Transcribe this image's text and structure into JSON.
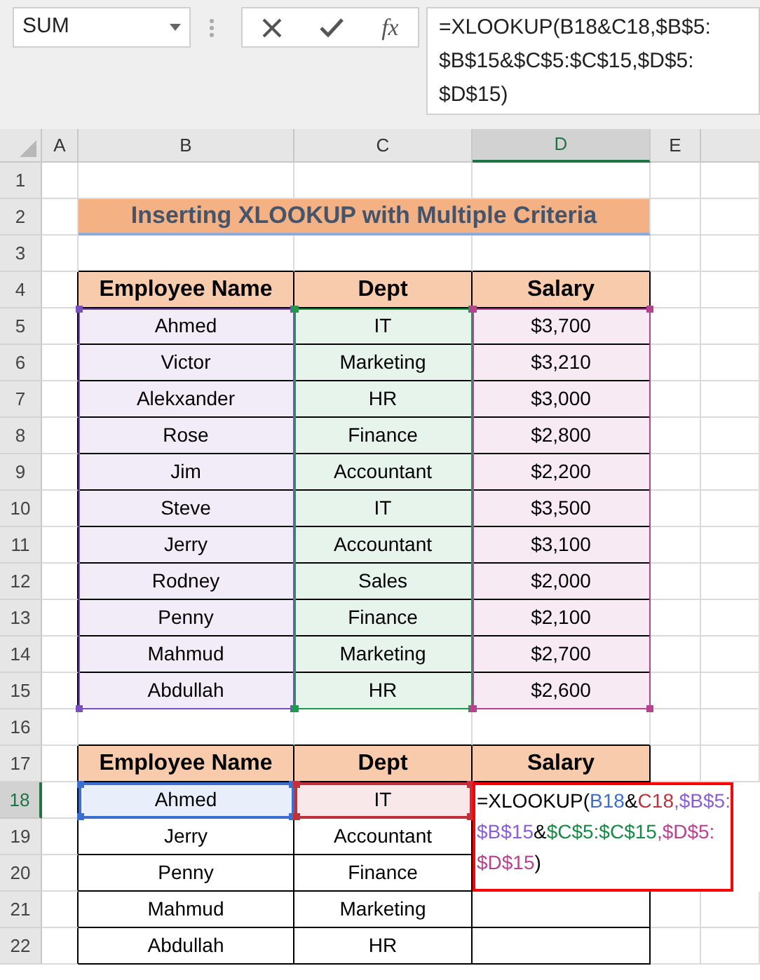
{
  "name_box": {
    "value": "SUM"
  },
  "function_button": {
    "label": "fx"
  },
  "formula_bar": {
    "lines": [
      "=XLOOKUP(B18&C18,$B$5:",
      "$B$15&$C$5:$C$15,$D$5:",
      "$D$15)"
    ]
  },
  "column_headers": [
    {
      "label": "A",
      "selected": false
    },
    {
      "label": "B",
      "selected": false
    },
    {
      "label": "C",
      "selected": false
    },
    {
      "label": "D",
      "selected": true
    },
    {
      "label": "E",
      "selected": false
    }
  ],
  "row_headers": [
    {
      "label": "1",
      "selected": false
    },
    {
      "label": "2",
      "selected": false
    },
    {
      "label": "3",
      "selected": false
    },
    {
      "label": "4",
      "selected": false
    },
    {
      "label": "5",
      "selected": false
    },
    {
      "label": "6",
      "selected": false
    },
    {
      "label": "7",
      "selected": false
    },
    {
      "label": "8",
      "selected": false
    },
    {
      "label": "9",
      "selected": false
    },
    {
      "label": "10",
      "selected": false
    },
    {
      "label": "11",
      "selected": false
    },
    {
      "label": "12",
      "selected": false
    },
    {
      "label": "13",
      "selected": false
    },
    {
      "label": "14",
      "selected": false
    },
    {
      "label": "15",
      "selected": false
    },
    {
      "label": "16",
      "selected": false
    },
    {
      "label": "17",
      "selected": false
    },
    {
      "label": "18",
      "selected": true
    },
    {
      "label": "19",
      "selected": false
    },
    {
      "label": "20",
      "selected": false
    },
    {
      "label": "21",
      "selected": false
    },
    {
      "label": "22",
      "selected": false
    }
  ],
  "title": "Inserting XLOOKUP with Multiple Criteria",
  "table1": {
    "columns": [
      {
        "label": "Employee Name",
        "color": "#7b4fc0"
      },
      {
        "label": "Dept",
        "color": "#1f9a4a"
      },
      {
        "label": "Salary",
        "color": "#b8428f"
      }
    ],
    "rows": [
      [
        "Ahmed",
        "IT",
        "$3,700"
      ],
      [
        "Victor",
        "Marketing",
        "$3,210"
      ],
      [
        "Alekxander",
        "HR",
        "$3,000"
      ],
      [
        "Rose",
        "Finance",
        "$2,800"
      ],
      [
        "Jim",
        "Accountant",
        "$2,200"
      ],
      [
        "Steve",
        "IT",
        "$3,500"
      ],
      [
        "Jerry",
        "Accountant",
        "$3,100"
      ],
      [
        "Rodney",
        "Sales",
        "$2,000"
      ],
      [
        "Penny",
        "Finance",
        "$2,100"
      ],
      [
        "Mahmud",
        "Marketing",
        "$2,700"
      ],
      [
        "Abdullah",
        "HR",
        "$2,600"
      ]
    ]
  },
  "table2": {
    "columns": [
      "Employee Name",
      "Dept",
      "Salary"
    ],
    "rows": [
      {
        "cells": [
          {
            "text": "Ahmed",
            "color": "#3a6fd0"
          },
          {
            "text": "IT",
            "color": "#c0313a"
          }
        ]
      },
      {
        "cells": [
          {
            "text": "Jerry"
          },
          {
            "text": "Accountant"
          }
        ]
      },
      {
        "cells": [
          {
            "text": "Penny"
          },
          {
            "text": "Finance"
          }
        ]
      },
      {
        "cells": [
          {
            "text": "Mahmud"
          },
          {
            "text": "Marketing"
          }
        ]
      },
      {
        "cells": [
          {
            "text": "Abdullah"
          },
          {
            "text": "HR"
          }
        ]
      }
    ],
    "formula_cell": {
      "lines": [
        [
          {
            "text": "=XLOOKUP(",
            "color": "#000000"
          },
          {
            "text": "B18",
            "color": "#3a6fd0"
          },
          {
            "text": "&",
            "color": "#000000"
          },
          {
            "text": "C18",
            "color": "#c0313a"
          },
          {
            "text": ",$B$5:",
            "color": "#8a5fd6"
          }
        ],
        [
          {
            "text": "$B$15",
            "color": "#8a5fd6"
          },
          {
            "text": "&",
            "color": "#000000"
          },
          {
            "text": "$C$5:$C$15",
            "color": "#168a45"
          },
          {
            "text": ",$D$5:",
            "color": "#b8428f"
          }
        ],
        [
          {
            "text": "$D$15",
            "color": "#b8428f"
          },
          {
            "text": ")",
            "color": "#000000"
          }
        ]
      ]
    }
  }
}
